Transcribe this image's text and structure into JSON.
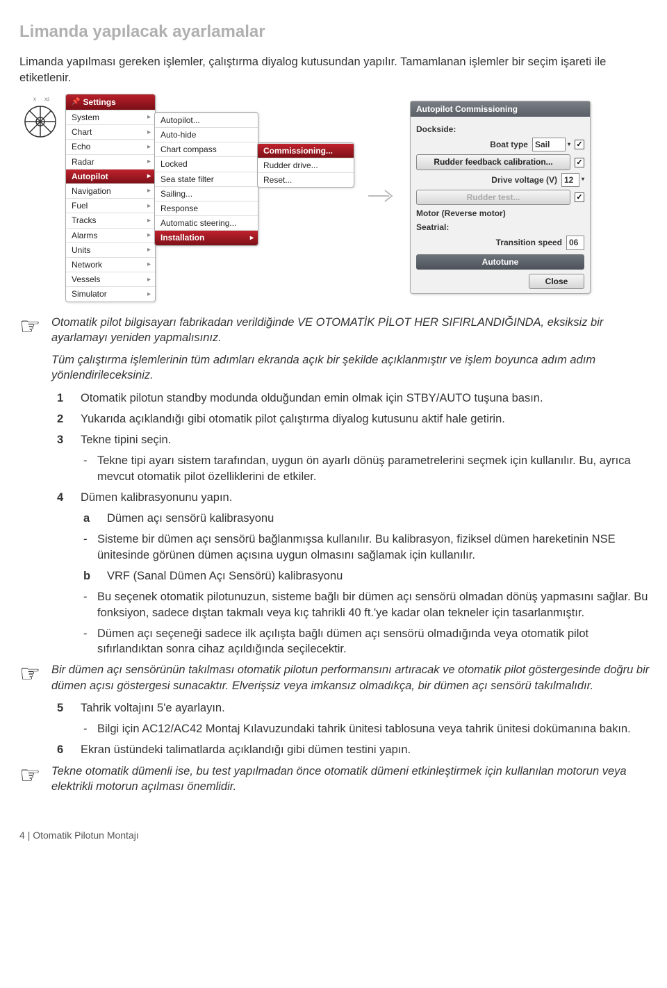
{
  "page": {
    "title": "Limanda yapılacak ayarlamalar",
    "intro": "Limanda yapılması gereken işlemler, çalıştırma diyalog kutusundan yapılır. Tamamlanan işlemler bir seçim işareti ile etiketlenir."
  },
  "menu1": {
    "header": "Settings",
    "items": [
      "System",
      "Chart",
      "Echo",
      "Radar",
      "Autopilot",
      "Navigation",
      "Fuel",
      "Tracks",
      "Alarms",
      "Units",
      "Network",
      "Vessels",
      "Simulator"
    ],
    "selected": "Autopilot"
  },
  "menu2": {
    "items": [
      "Autopilot...",
      "Auto-hide",
      "Chart compass",
      "Locked",
      "Sea state filter",
      "Sailing...",
      "Response",
      "Automatic steering...",
      "Installation"
    ],
    "selected": "Installation"
  },
  "menu3": {
    "items": [
      "Commissioning...",
      "Rudder drive...",
      "Reset..."
    ],
    "selected": "Commissioning..."
  },
  "dialog": {
    "title": "Autopilot Commissioning",
    "dockside": "Dockside:",
    "boatTypeLabel": "Boat type",
    "boatTypeValue": "Sail",
    "rudderCal": "Rudder feedback calibration...",
    "driveVoltage": "Drive voltage (V)",
    "driveVoltageValue": "12",
    "rudderTest": "Rudder test...",
    "motor": "Motor (Reverse motor)",
    "seatrial": "Seatrial:",
    "transitionSpeed": "Transition speed",
    "transitionSpeedValue": "06",
    "autotune": "Autotune",
    "close": "Close"
  },
  "note1a": "Otomatik pilot bilgisayarı fabrikadan verildiğinde VE OTOMATİK PİLOT HER SIFIRLANDIĞINDA, eksiksiz bir ayarlamayı yeniden yapmalısınız.",
  "note1b": "Tüm çalıştırma işlemlerinin tüm adımları ekranda açık bir şekilde açıklanmıştır ve işlem boyunca adım adım yönlendirileceksiniz.",
  "steps": {
    "s1": "Otomatik pilotun standby modunda olduğundan emin olmak için STBY/AUTO tuşuna basın.",
    "s2": "Yukarıda açıklandığı gibi otomatik pilot çalıştırma diyalog kutusunu aktif hale getirin.",
    "s3": "Tekne tipini seçin.",
    "s3a": "Tekne tipi ayarı sistem tarafından, uygun ön ayarlı dönüş parametrelerini seçmek için kullanılır. Bu, ayrıca mevcut otomatik pilot özelliklerini de etkiler.",
    "s4": "Dümen kalibrasyonunu yapın.",
    "s4a_label": "a",
    "s4a_text": "Dümen açı sensörü kalibrasyonu",
    "s4a_dash": "Sisteme bir dümen açı sensörü bağlanmışsa kullanılır. Bu kalibrasyon, fiziksel dümen hareketinin NSE ünitesinde görünen dümen açısına uygun olmasını sağlamak için kullanılır.",
    "s4b_label": "b",
    "s4b_text": "VRF (Sanal Dümen Açı Sensörü) kalibrasyonu",
    "s4b_dash1": "Bu seçenek otomatik pilotunuzun, sisteme bağlı bir dümen açı sensörü olmadan dönüş yapmasını sağlar. Bu fonksiyon, sadece dıştan takmalı veya kıç tahrikli 40 ft.'ye kadar olan tekneler için tasarlanmıştır.",
    "s4b_dash2": "Dümen açı seçeneği sadece ilk açılışta bağlı dümen açı sensörü olmadığında veya otomatik pilot sıfırlandıktan sonra cihaz açıldığında seçilecektir."
  },
  "note2": "Bir dümen açı sensörünün takılması otomatik pilotun performansını artıracak ve otomatik pilot göstergesinde doğru bir dümen açısı göstergesi sunacaktır. Elverişsiz veya imkansız olmadıkça, bir dümen açı sensörü takılmalıdır.",
  "steps2": {
    "s5": "Tahrik voltajını 5'e ayarlayın.",
    "s5a": "Bilgi için AC12/AC42 Montaj Kılavuzundaki tahrik ünitesi tablosuna veya tahrik ünitesi dokümanına bakın.",
    "s6": "Ekran üstündeki talimatlarda açıklandığı gibi dümen testini yapın."
  },
  "note3": "Tekne otomatik dümenli ise, bu test yapılmadan önce otomatik dümeni etkinleştirmek için kullanılan motorun veya elektrikli motorun açılması önemlidir.",
  "footer": {
    "page": "4",
    "sep": "|",
    "section": "Otomatik Pilotun Montajı"
  }
}
